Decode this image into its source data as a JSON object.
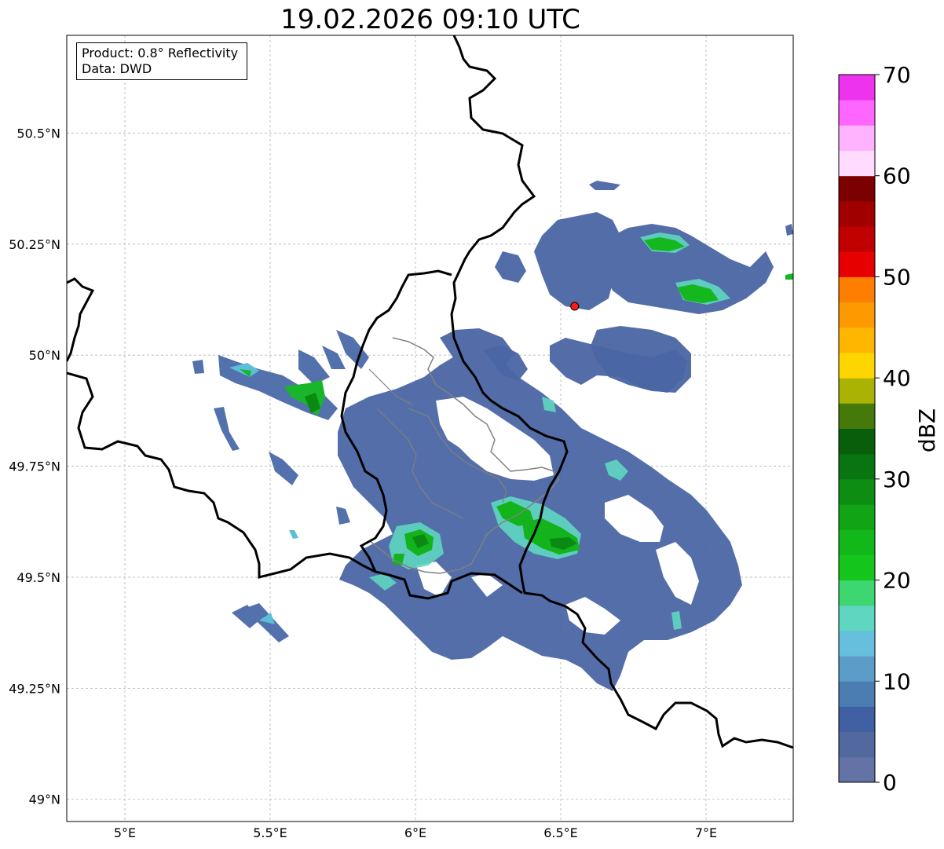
{
  "title": "19.02.2026 09:10 UTC",
  "info": {
    "product": "Product: 0.8° Reflectivity",
    "source": "Data: DWD"
  },
  "map": {
    "lon_range": [
      4.8,
      7.3
    ],
    "lat_range": [
      48.95,
      50.72
    ],
    "lon_ticks": [
      {
        "value": 5.0,
        "label": "5°E"
      },
      {
        "value": 5.5,
        "label": "5.5°E"
      },
      {
        "value": 6.0,
        "label": "6°E"
      },
      {
        "value": 6.5,
        "label": "6.5°E"
      },
      {
        "value": 7.0,
        "label": "7°E"
      }
    ],
    "lat_ticks": [
      {
        "value": 49.0,
        "label": "49°N"
      },
      {
        "value": 49.25,
        "label": "49.25°N"
      },
      {
        "value": 49.5,
        "label": "49.5°N"
      },
      {
        "value": 49.75,
        "label": "49.75°N"
      },
      {
        "value": 50.0,
        "label": "50°N"
      },
      {
        "value": 50.25,
        "label": "50.25°N"
      },
      {
        "value": 50.5,
        "label": "50.5°N"
      }
    ],
    "grid": true,
    "radar_site": {
      "lon": 6.548,
      "lat": 50.11,
      "color": "#ff1a1a"
    }
  },
  "colorbar": {
    "label": "dBZ",
    "min": 0,
    "max": 70,
    "step": 2.5,
    "tick_labels": [
      "0",
      "10",
      "20",
      "30",
      "40",
      "50",
      "60",
      "70"
    ],
    "tick_values": [
      0,
      10,
      20,
      30,
      40,
      50,
      60,
      70
    ],
    "colors": [
      "#6373a6",
      "#51699e",
      "#415fa3",
      "#4b7db3",
      "#5c9cc8",
      "#66bfdc",
      "#5fd6c0",
      "#3dd671",
      "#14c61c",
      "#12b81a",
      "#11a515",
      "#0d8e12",
      "#097511",
      "#085e0b",
      "#457a0a",
      "#aab304",
      "#ffd500",
      "#ffb600",
      "#ff9900",
      "#ff7e00",
      "#e60000",
      "#c00000",
      "#a10000",
      "#7d0000",
      "#ffdcff",
      "#ffb3ff",
      "#ff66ff",
      "#ee33ee"
    ]
  }
}
